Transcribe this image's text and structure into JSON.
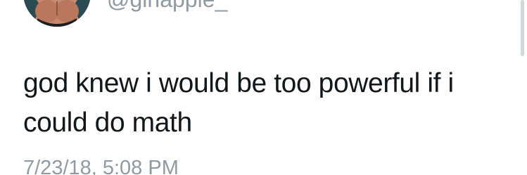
{
  "tweet": {
    "handle": "@ginapple_",
    "text": "god knew i would be too powerful if i could do math",
    "timestamp": "7/23/18, 5:08 PM"
  }
}
